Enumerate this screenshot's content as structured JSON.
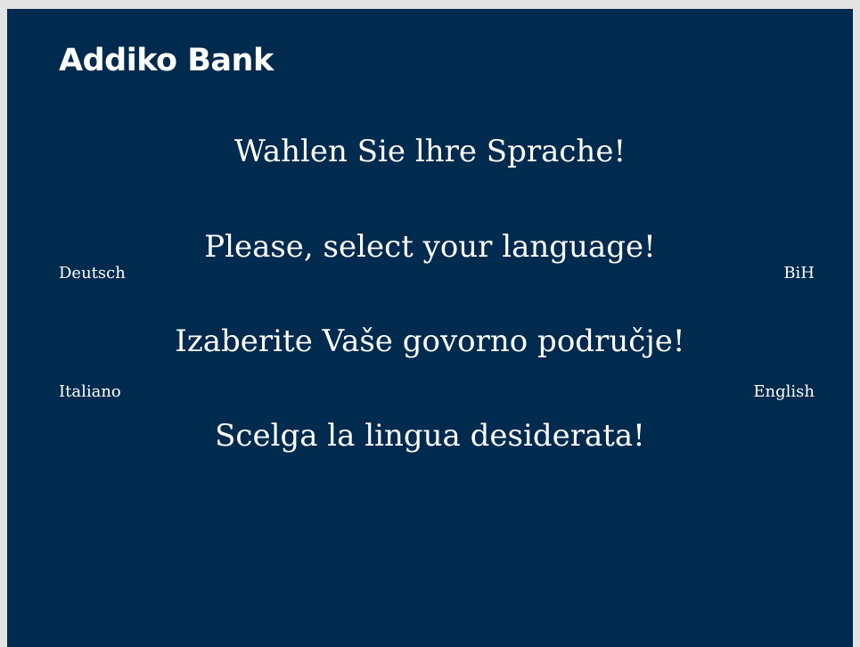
{
  "brand": {
    "logo_text": "Addiko Bank"
  },
  "prompts": [
    "Wahlen Sie lhre Sprache!",
    "Please, select your language!",
    "Izaberite Vaše govorno područje!",
    "Scelga la lingua desiderata!"
  ],
  "languages": {
    "deutsch": "Deutsch",
    "bih": "BiH",
    "italiano": "Italiano",
    "english": "English"
  },
  "colors": {
    "background": "#002a4e",
    "outer": "#e3e3e3",
    "text": "#ffffff"
  }
}
